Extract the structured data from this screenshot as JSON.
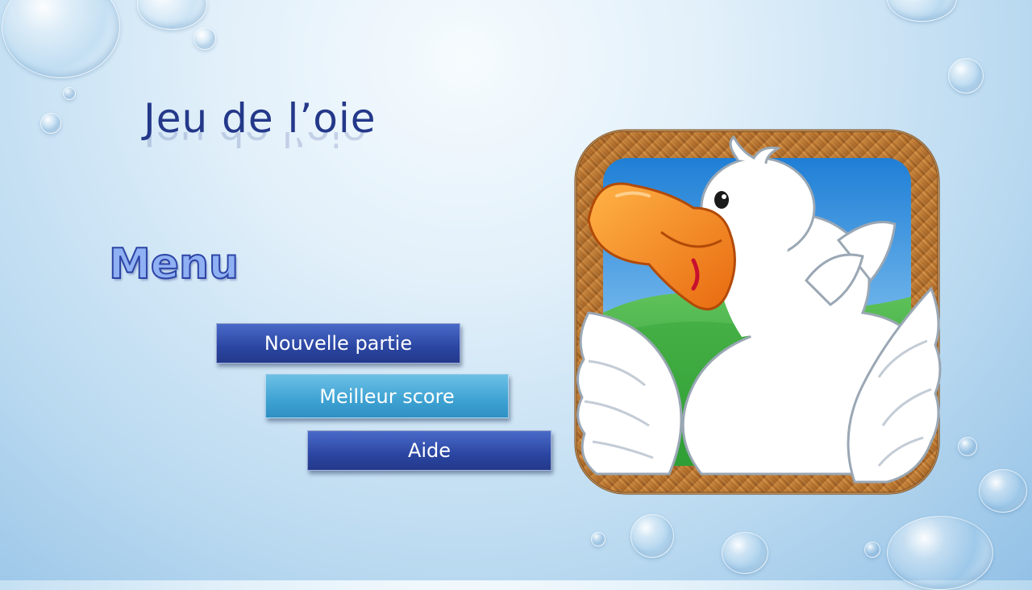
{
  "title": "Jeu de l’oie",
  "menu_heading": "Menu",
  "buttons": {
    "new_game": "Nouvelle partie",
    "best_score": "Meilleur score",
    "help": "Aide"
  },
  "colors": {
    "title": "#24388a",
    "button_primary": "#2b46a2",
    "button_secondary": "#3ea2d2",
    "frame_wood": "#b8742f"
  },
  "image": {
    "icon": "goose-app-icon"
  }
}
